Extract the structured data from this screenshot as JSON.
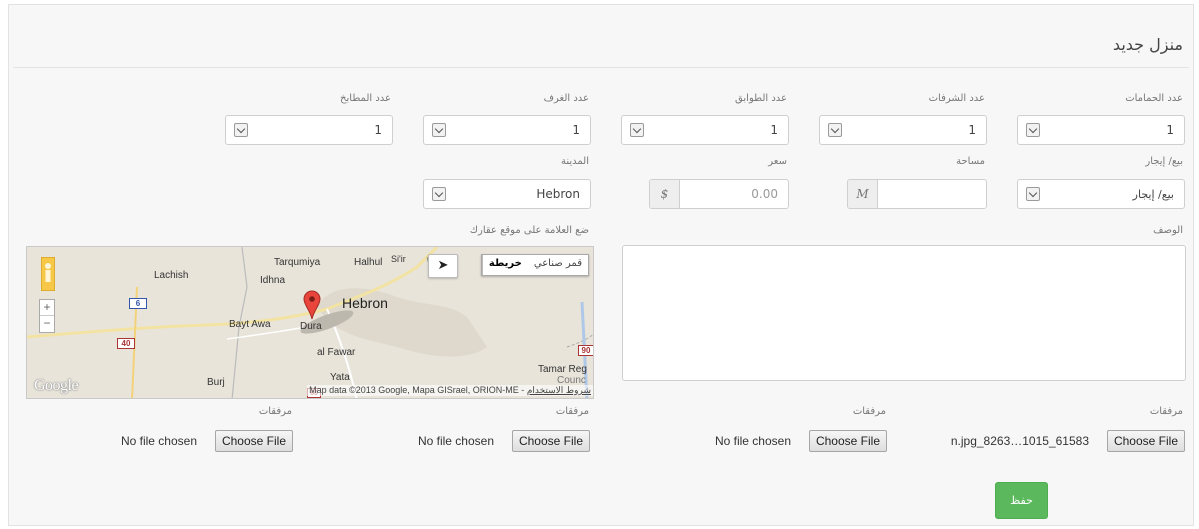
{
  "form": {
    "title": "منزل جديد",
    "row1": [
      {
        "label": "عدد الحمامات",
        "value": "1"
      },
      {
        "label": "عدد الشرفات",
        "value": "1"
      },
      {
        "label": "عدد الطوابق",
        "value": "1"
      },
      {
        "label": "عدد الغرف",
        "value": "1"
      },
      {
        "label": "عدد المطابخ",
        "value": "1"
      }
    ],
    "sale_type": {
      "label": "بيع/ إيجار",
      "value": "بيع/ إيجار"
    },
    "area": {
      "label": "مساحة",
      "addon": "M",
      "value": ""
    },
    "price": {
      "label": "سعر",
      "addon": "$",
      "value": "0.00"
    },
    "city": {
      "label": "المدينة",
      "value": "Hebron"
    },
    "description": {
      "label": "الوصف",
      "value": ""
    },
    "map": {
      "label": "ضع العلامة على موقع عقارك",
      "toggle_map": "خريطة",
      "toggle_satellite": "قمر صناعي",
      "places": {
        "tarqumiya": "Tarqumiya",
        "halhul": "Halhul",
        "sir": "Si'ir",
        "lachish": "Lachish",
        "idhna": "Idhna",
        "hebron": "Hebron",
        "bayt_awa": "Bayt Awa",
        "dura": "Dura",
        "al_fawar": "al Fawar",
        "tamar": "Tamar Reg",
        "council": "Counc",
        "burj": "Burj",
        "yata": "Yata"
      },
      "roads": [
        "6",
        "40",
        "90",
        "60"
      ],
      "attribution": "Map data ©2013 Google, Mapa GISrael, ORION-ME - ",
      "terms": "شروط الاستخدام",
      "logo": "Google"
    },
    "attachments": [
      {
        "label": "مرفقات",
        "status": "n.jpg_8263…1015_61583",
        "button": "Choose File"
      },
      {
        "label": "مرفقات",
        "status": "No file chosen",
        "button": "Choose File"
      },
      {
        "label": "مرفقات",
        "status": "No file chosen",
        "button": "Choose File"
      },
      {
        "label": "مرفقات",
        "status": "No file chosen",
        "button": "Choose File"
      }
    ],
    "save_label": "حفظ"
  }
}
